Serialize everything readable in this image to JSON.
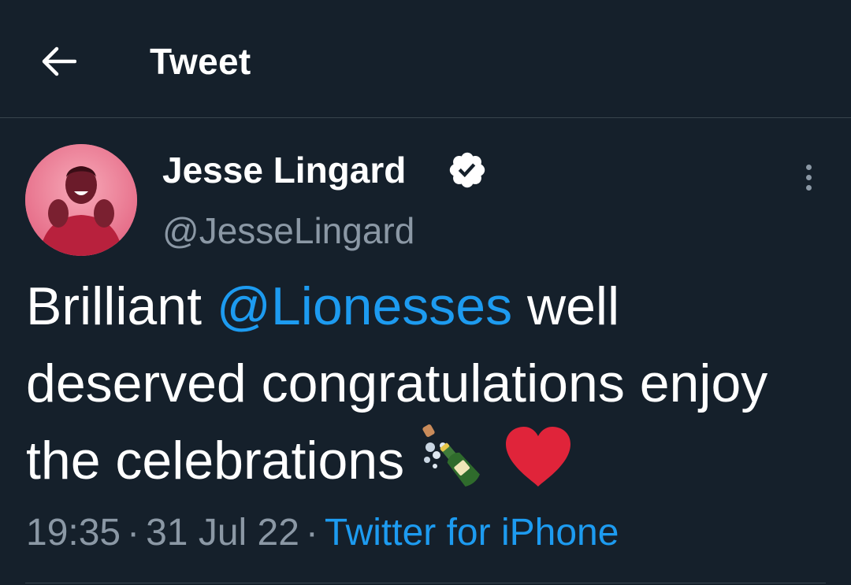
{
  "header": {
    "title": "Tweet",
    "back_icon": "arrow-left-icon"
  },
  "tweet": {
    "author": {
      "name": "Jesse Lingard",
      "handle": "@JesseLingard",
      "verified": true
    },
    "text": {
      "part1": "Brilliant ",
      "mention": "@Lionesses",
      "part2": " well deserved congratulations enjoy the celebrations ",
      "emoji1": "bottle-with-popping-cork-emoji",
      "emoji2": "red-heart-emoji"
    },
    "time": "19:35",
    "date": "31 Jul 22",
    "separator": "·",
    "source": "Twitter for iPhone"
  },
  "colors": {
    "background": "#15202b",
    "accent": "#1d9bf0",
    "secondary_text": "#8b98a5",
    "divider": "#38444d",
    "heart": "#e0243a"
  }
}
